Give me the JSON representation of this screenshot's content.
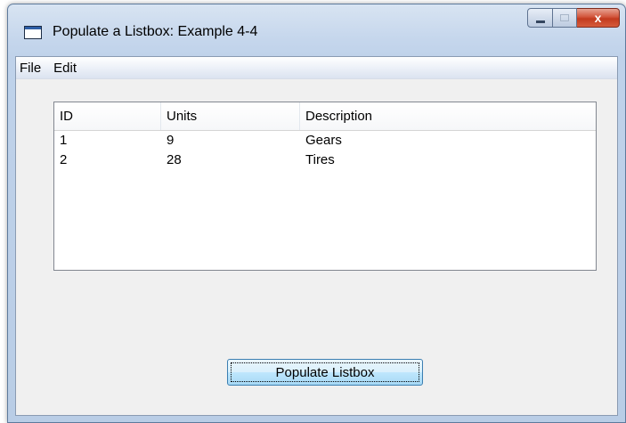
{
  "window": {
    "title": "Populate a Listbox: Example 4-4",
    "close_glyph": "x"
  },
  "menubar": {
    "items": [
      {
        "label": "File"
      },
      {
        "label": "Edit"
      }
    ]
  },
  "listview": {
    "columns": [
      "ID",
      "Units",
      "Description"
    ],
    "rows": [
      {
        "id": "1",
        "units": "9",
        "description": "Gears"
      },
      {
        "id": "2",
        "units": "28",
        "description": "Tires"
      }
    ]
  },
  "button": {
    "label": "Populate Listbox"
  },
  "colors": {
    "close_button": "#c23a1e",
    "button_border": "#3c7fb1",
    "client_bg": "#f0f0f0"
  }
}
